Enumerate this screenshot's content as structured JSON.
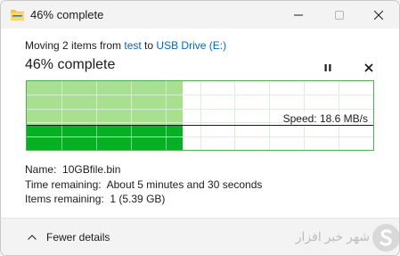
{
  "window": {
    "title": "46% complete",
    "minimize_icon": "minimize-icon",
    "maximize_icon": "maximize-icon",
    "close_icon": "close-icon"
  },
  "operation": {
    "prefix": "Moving 2 items from ",
    "source": "test",
    "middle": " to ",
    "destination": "USB Drive (E:)",
    "percent_text": "46% complete",
    "progress": 0.46
  },
  "controls": {
    "pause_icon": "pause-icon",
    "cancel_icon": "cancel-icon"
  },
  "graph": {
    "speed_label": "Speed: 18.6 MB/s",
    "fill_color_light": "#a8e08f",
    "fill_color_dark": "#06b025",
    "border_color": "#4cb050"
  },
  "details": {
    "name_label": "Name:",
    "name_value": "10GBfile.bin",
    "time_label": "Time remaining:",
    "time_value": "About 5 minutes and 30 seconds",
    "items_label": "Items remaining:",
    "items_value": "1 (5.39 GB)"
  },
  "footer": {
    "fewer_details_label": "Fewer details",
    "chevron_icon": "chevron-up-icon"
  },
  "watermark": {
    "text": "شهر خبر افزار",
    "logo_icon": "s-logo-icon"
  }
}
